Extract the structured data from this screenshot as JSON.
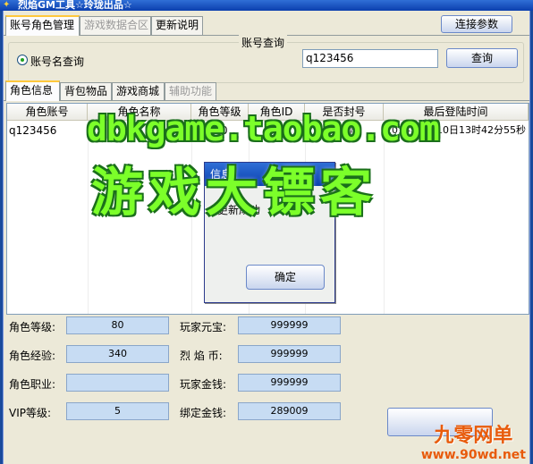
{
  "window": {
    "title": "烈焰GM工具☆玲珑出品☆"
  },
  "top_tabs": [
    {
      "label": "账号角色管理",
      "active": true,
      "enabled": true
    },
    {
      "label": "游戏数据合区",
      "active": false,
      "enabled": false
    },
    {
      "label": "更新说明",
      "active": false,
      "enabled": true
    }
  ],
  "connect_button": "连接参数",
  "account_query": {
    "group_title": "账号查询",
    "radio_label": "账号名查询",
    "search_value": "q123456",
    "search_button": "查询"
  },
  "sub_tabs": [
    {
      "label": "角色信息",
      "active": true,
      "enabled": true
    },
    {
      "label": "背包物品",
      "active": false,
      "enabled": true
    },
    {
      "label": "游戏商城",
      "active": false,
      "enabled": true
    },
    {
      "label": "辅助功能",
      "active": false,
      "enabled": false
    }
  ],
  "grid": {
    "columns": [
      "角色账号",
      "角色名称",
      "角色等级",
      "角色ID",
      "是否封号",
      "最后登陆时间"
    ],
    "rows": [
      {
        "account": "q123456",
        "name": "",
        "level": "80",
        "id": "",
        "banned": "正常",
        "last_login": "2014年5月10日13时42分55秒"
      }
    ]
  },
  "dialog": {
    "title": "信息",
    "message": "更新成功",
    "ok_button": "确定"
  },
  "details": {
    "left": [
      {
        "label": "角色等级:",
        "value": "80"
      },
      {
        "label": "角色经验:",
        "value": "340"
      },
      {
        "label": "角色职业:",
        "value": ""
      },
      {
        "label": "VIP等级:",
        "value": "5"
      }
    ],
    "right": [
      {
        "label": "玩家元宝:",
        "value": "999999"
      },
      {
        "label": "烈 焰 币:",
        "value": "999999"
      },
      {
        "label": "玩家金钱:",
        "value": "999999"
      },
      {
        "label": "绑定金钱:",
        "value": "289009"
      }
    ]
  },
  "watermarks": {
    "url": "dbkgame.taobao.com",
    "name": "游戏大镖客",
    "logo_big": "九零网单",
    "logo_small": "www.90wd.net"
  },
  "colors": {
    "watermark_green": "#7cff2a",
    "title_blue": "#0b3fae",
    "value_bg": "#c7dcf3",
    "logo_orange": "#e85b0c"
  }
}
